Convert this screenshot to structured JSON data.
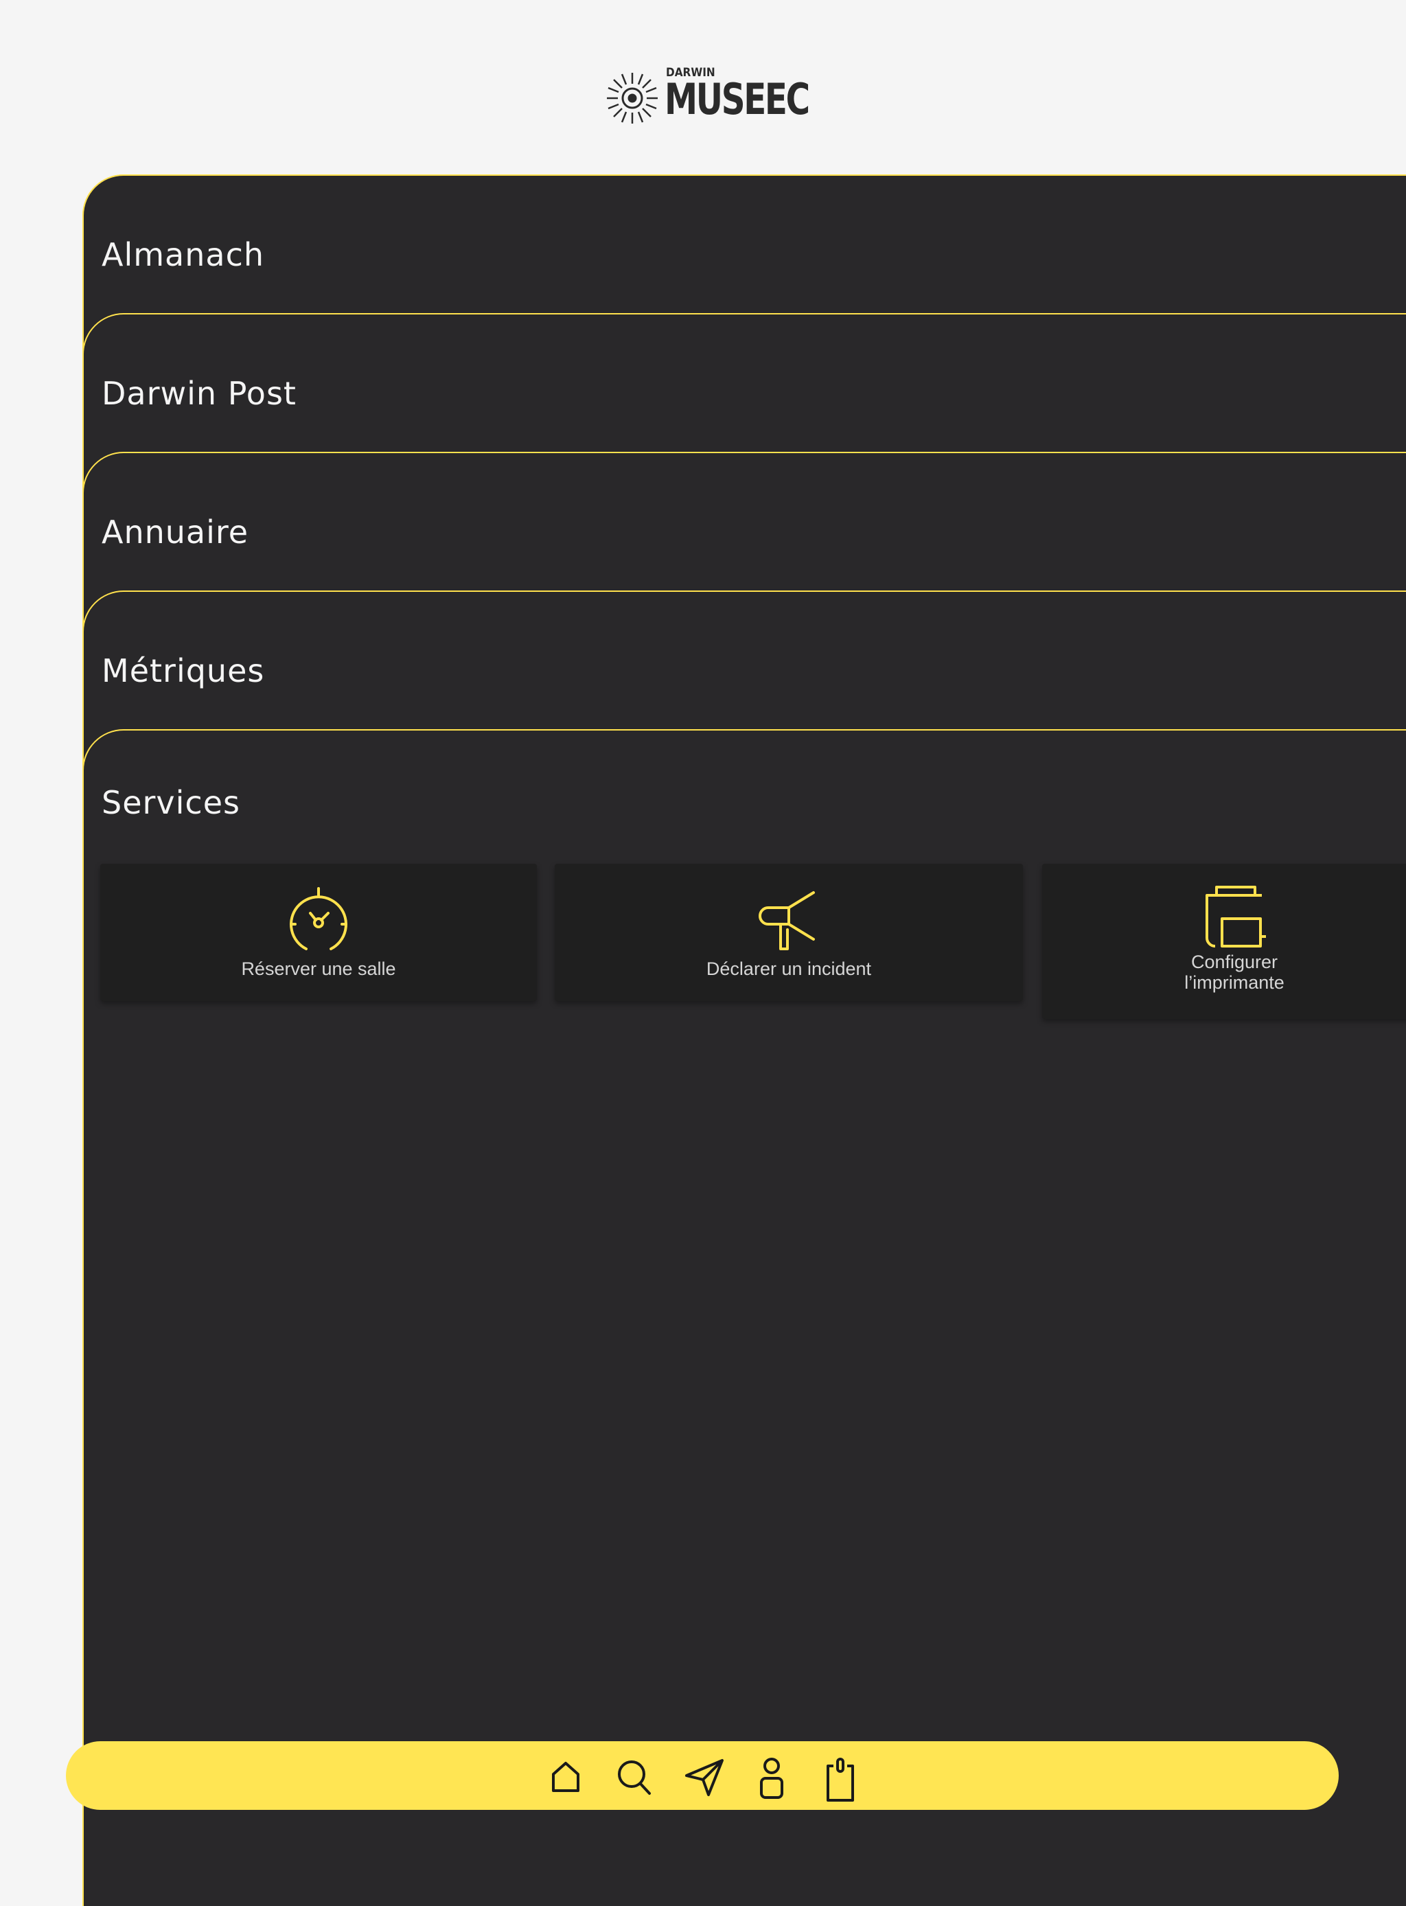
{
  "brand": {
    "top": "DARWIN",
    "name": "MUSEEC"
  },
  "sections": [
    {
      "label": "Almanach"
    },
    {
      "label": "Darwin Post"
    },
    {
      "label": "Annuaire"
    },
    {
      "label": "Métriques"
    },
    {
      "label": "Services"
    }
  ],
  "services": [
    {
      "label": "Réserver une salle",
      "icon": "stopwatch-icon"
    },
    {
      "label": "Déclarer un incident",
      "icon": "megaphone-icon"
    },
    {
      "label_line1": "Configurer",
      "label_line2": "l’imprimante",
      "icon": "printer-icon"
    }
  ],
  "tabbar": {
    "items": [
      "home-icon",
      "search-icon",
      "send-icon",
      "profile-icon",
      "badge-icon"
    ]
  },
  "colors": {
    "accent": "#ffe553",
    "panel": "#29282a",
    "card": "#1f1f1f"
  }
}
